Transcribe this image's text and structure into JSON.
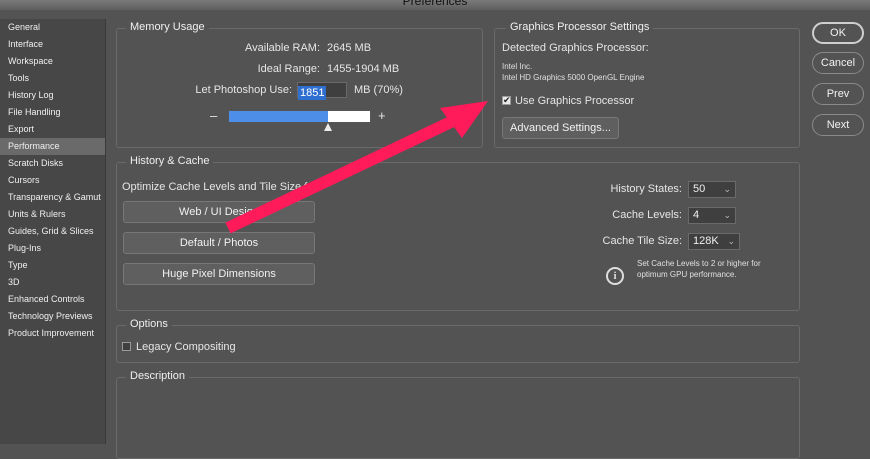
{
  "window": {
    "title": "Preferences"
  },
  "sidebar": {
    "items": [
      {
        "label": "General"
      },
      {
        "label": "Interface"
      },
      {
        "label": "Workspace"
      },
      {
        "label": "Tools"
      },
      {
        "label": "History Log"
      },
      {
        "label": "File Handling"
      },
      {
        "label": "Export"
      },
      {
        "label": "Performance"
      },
      {
        "label": "Scratch Disks"
      },
      {
        "label": "Cursors"
      },
      {
        "label": "Transparency & Gamut"
      },
      {
        "label": "Units & Rulers"
      },
      {
        "label": "Guides, Grid & Slices"
      },
      {
        "label": "Plug-Ins"
      },
      {
        "label": "Type"
      },
      {
        "label": "3D"
      },
      {
        "label": "Enhanced Controls"
      },
      {
        "label": "Technology Previews"
      },
      {
        "label": "Product Improvement"
      }
    ],
    "selected": "Performance"
  },
  "memory": {
    "title": "Memory Usage",
    "available_label": "Available RAM:",
    "available_value": "2645 MB",
    "ideal_label": "Ideal Range:",
    "ideal_value": "1455-1904 MB",
    "use_label": "Let Photoshop Use:",
    "use_value": "1851",
    "use_unit": "MB (70%)",
    "minus": "–",
    "plus": "+",
    "slider_fraction": 0.7
  },
  "gpu": {
    "title": "Graphics Processor Settings",
    "detected_label": "Detected Graphics Processor:",
    "vendor": "Intel Inc.",
    "engine": "Intel HD Graphics 5000 OpenGL Engine",
    "use_label": "Use Graphics Processor",
    "checkmark": "✔",
    "advanced_button": "Advanced Settings..."
  },
  "cache": {
    "title": "History & Cache",
    "optimize_label": "Optimize Cache Levels and Tile Size for:",
    "buttons": [
      "Web / UI Design",
      "Default / Photos",
      "Huge Pixel Dimensions"
    ],
    "history_label": "History States:",
    "history_value": "50",
    "levels_label": "Cache Levels:",
    "levels_value": "4",
    "tile_label": "Cache Tile Size:",
    "tile_value": "128K",
    "chevron": "⌄",
    "info_icon": "i",
    "info_line1": "Set Cache Levels to 2 or higher for",
    "info_line2": "optimum GPU performance."
  },
  "options": {
    "title": "Options",
    "legacy_label": "Legacy Compositing"
  },
  "description": {
    "title": "Description"
  },
  "actions": {
    "ok": "OK",
    "cancel": "Cancel",
    "prev": "Prev",
    "next": "Next"
  },
  "annotation_color": "#ff1a5a"
}
